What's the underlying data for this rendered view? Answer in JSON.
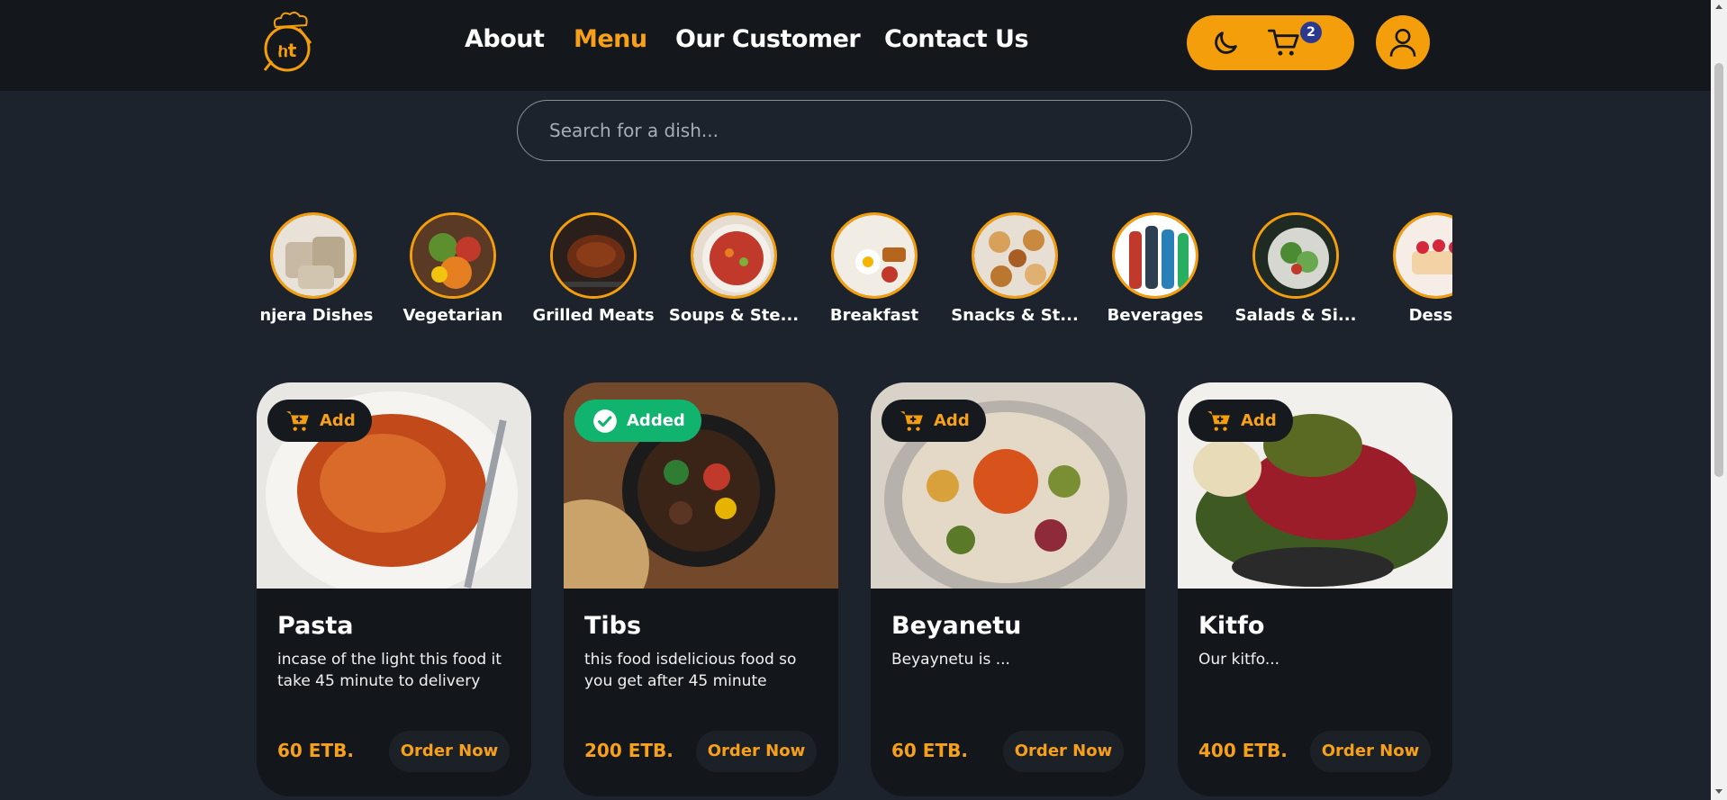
{
  "header": {
    "logo_text": "ከt",
    "nav": [
      {
        "label": "About",
        "active": false
      },
      {
        "label": "Menu",
        "active": true
      },
      {
        "label": "Our Customer",
        "active": false
      },
      {
        "label": "Contact Us",
        "active": false
      }
    ],
    "cart_count": "2",
    "icons": {
      "theme": "moon-icon",
      "cart": "cart-icon",
      "user": "user-icon"
    }
  },
  "search": {
    "placeholder": "Search for a dish...",
    "value": ""
  },
  "categories": [
    {
      "label": "Injera Dishes"
    },
    {
      "label": "Vegetarian"
    },
    {
      "label": "Grilled Meats"
    },
    {
      "label": "Soups & Ste..."
    },
    {
      "label": "Breakfast"
    },
    {
      "label": "Snacks & St..."
    },
    {
      "label": "Beverages"
    },
    {
      "label": "Salads & Si..."
    },
    {
      "label": "Desse"
    }
  ],
  "dishes": [
    {
      "name": "Pasta",
      "description": "incase of the light this food it take 45 minute to delivery",
      "price": "60 ETB.",
      "add_label": "Add",
      "order_label": "Order Now",
      "added": false
    },
    {
      "name": "Tibs",
      "description": "this food isdelicious food so you get after 45 minute",
      "price": "200 ETB.",
      "add_label": "Added",
      "order_label": "Order Now",
      "added": true
    },
    {
      "name": "Beyanetu",
      "description": "Beyaynetu is ...",
      "price": "60 ETB.",
      "add_label": "Add",
      "order_label": "Order Now",
      "added": false
    },
    {
      "name": "Kitfo",
      "description": "Our kitfo...",
      "price": "400 ETB.",
      "add_label": "Add",
      "order_label": "Order Now",
      "added": false
    }
  ],
  "colors": {
    "accent": "#f59e0b",
    "background": "#1c232c",
    "header": "#14181d",
    "card": "#13171c",
    "added": "#10b46f"
  }
}
